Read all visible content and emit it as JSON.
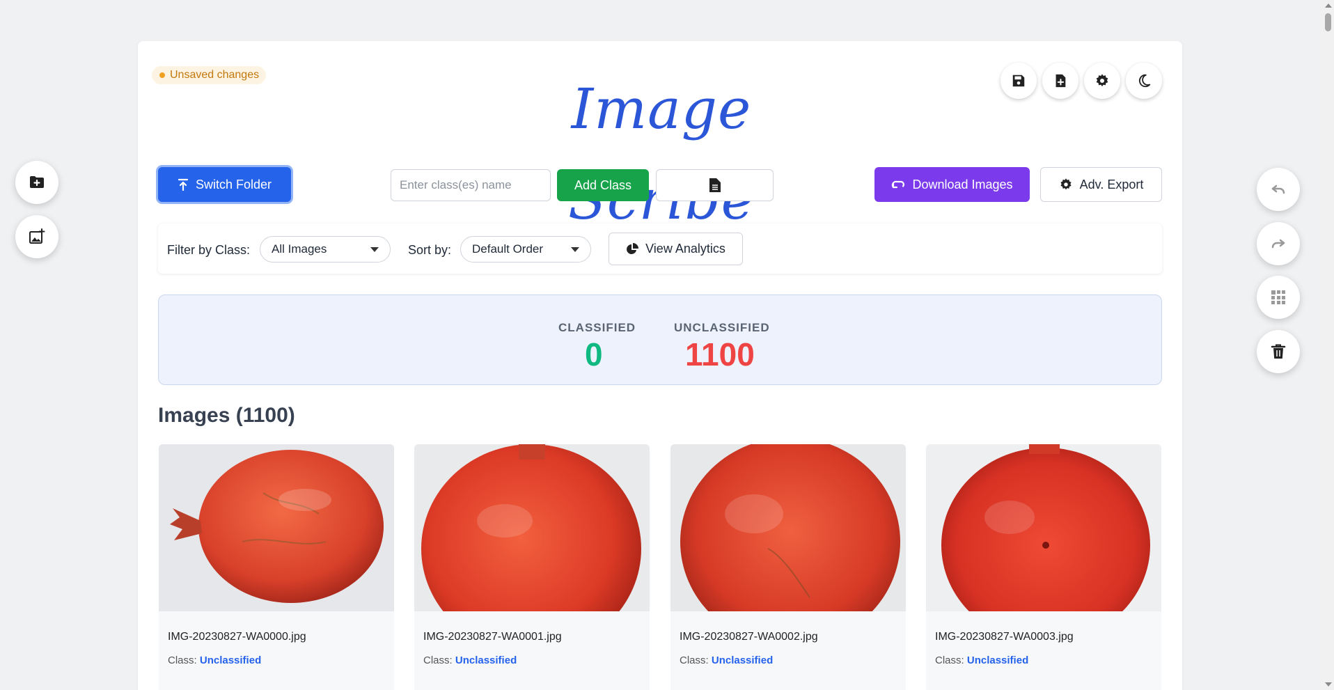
{
  "app": {
    "title": "Image Scribe",
    "unsaved_label": "Unsaved changes"
  },
  "toolbar": {
    "switch_folder_label": "Switch Folder",
    "class_input_placeholder": "Enter class(es) name",
    "class_input_value": "",
    "add_class_label": "Add Class",
    "download_label": "Download Images",
    "adv_export_label": "Adv. Export"
  },
  "filters": {
    "filter_label": "Filter by Class:",
    "filter_value": "All Images",
    "sort_label": "Sort by:",
    "sort_value": "Default Order",
    "analytics_label": "View Analytics"
  },
  "stats": {
    "classified_label": "CLASSIFIED",
    "classified_value": "0",
    "unclassified_label": "UNCLASSIFIED",
    "unclassified_value": "1100"
  },
  "images": {
    "heading": "Images (1100)",
    "class_prefix": "Class:",
    "items": [
      {
        "filename": "IMG-20230827-WA0000.jpg",
        "class": "Unclassified"
      },
      {
        "filename": "IMG-20230827-WA0001.jpg",
        "class": "Unclassified"
      },
      {
        "filename": "IMG-20230827-WA0002.jpg",
        "class": "Unclassified"
      },
      {
        "filename": "IMG-20230827-WA0003.jpg",
        "class": "Unclassified"
      }
    ]
  },
  "colors": {
    "primary": "#2563eb",
    "success": "#16a34a",
    "purple": "#7c3aed",
    "classified": "#10b981",
    "unclassified": "#ef4444"
  },
  "icons": {
    "left_fabs": [
      "folder-plus-icon",
      "image-plus-icon"
    ],
    "right_fabs": [
      "undo-icon",
      "redo-icon",
      "grid-icon",
      "trash-icon"
    ],
    "top_actions": [
      "save-icon",
      "file-plus-icon",
      "gear-icon",
      "moon-icon"
    ]
  }
}
